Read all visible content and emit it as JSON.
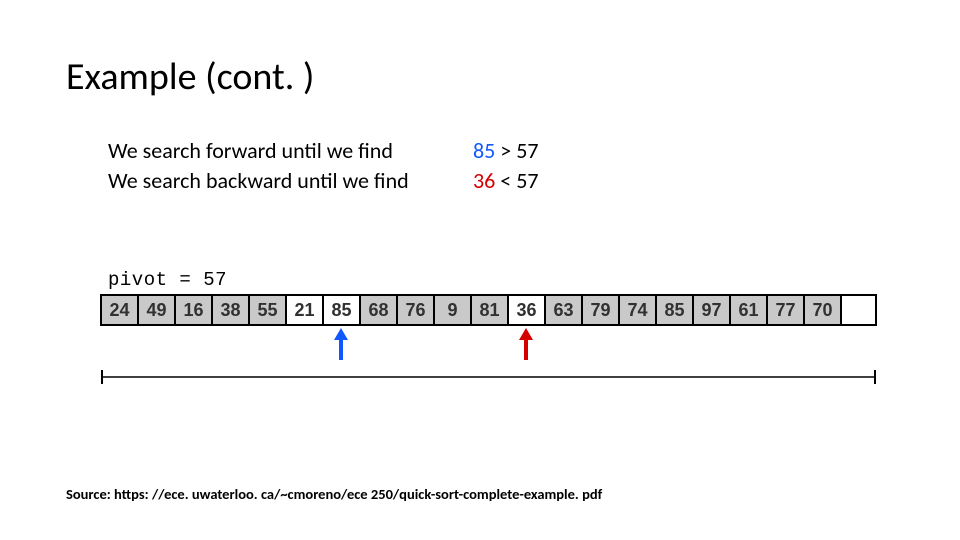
{
  "title": "Example (cont. )",
  "body": {
    "line1_lhs": "We search forward until we find",
    "line1_val": "85",
    "line1_cmp": " > 57",
    "line2_lhs": "We search backward until we find",
    "line2_val": "36",
    "line2_cmp": " < 57"
  },
  "pivot_label": "pivot = 57",
  "cells": {
    "c0": "24",
    "c1": "49",
    "c2": "16",
    "c3": "38",
    "c4": "55",
    "c5": "21",
    "c6": "85",
    "c7": "68",
    "c8": "76",
    "c9": "9",
    "c10": "81",
    "c11": "36",
    "c12": "63",
    "c13": "79",
    "c14": "74",
    "c15": "85",
    "c16": "97",
    "c17": "61",
    "c18": "77",
    "c19": "70",
    "c20": ""
  },
  "chart_data": {
    "type": "table",
    "pivot": 57,
    "forward_pointer_index": 6,
    "forward_pointer_value": 85,
    "backward_pointer_index": 11,
    "backward_pointer_value": 36,
    "array": [
      24,
      49,
      16,
      38,
      55,
      21,
      85,
      68,
      76,
      9,
      81,
      36,
      63,
      79,
      74,
      85,
      97,
      61,
      77,
      70,
      null
    ],
    "highlighted_white_indices": [
      5,
      6,
      11
    ],
    "colors": {
      "forward": "#1057ff",
      "backward": "#d40000"
    }
  },
  "source": "Source: https: //ece. uwaterloo. ca/~cmoreno/ece 250/quick-sort-complete-example. pdf"
}
